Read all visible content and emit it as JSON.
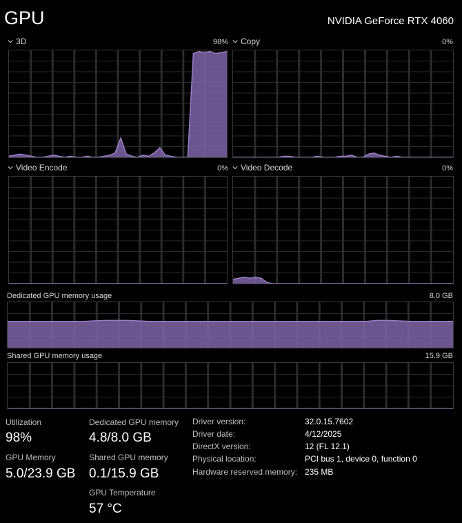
{
  "header": {
    "title": "GPU",
    "adapter_name": "NVIDIA GeForce RTX 4060"
  },
  "engines": [
    {
      "name": "3D",
      "percent": "98%"
    },
    {
      "name": "Copy",
      "percent": "0%"
    },
    {
      "name": "Video Encode",
      "percent": "0%"
    },
    {
      "name": "Video Decode",
      "percent": "0%"
    }
  ],
  "memory_graphs": [
    {
      "label": "Dedicated GPU memory usage",
      "max": "8.0 GB"
    },
    {
      "label": "Shared GPU memory usage",
      "max": "15.9 GB"
    }
  ],
  "stats": {
    "utilization": {
      "label": "Utilization",
      "value": "98%"
    },
    "gpu_memory": {
      "label": "GPU Memory",
      "value": "5.0/23.9 GB"
    },
    "dedicated": {
      "label": "Dedicated GPU memory",
      "value": "4.8/8.0 GB"
    },
    "shared": {
      "label": "Shared GPU memory",
      "value": "0.1/15.9 GB"
    },
    "temperature": {
      "label": "GPU Temperature",
      "value": "57 °C"
    }
  },
  "details": [
    {
      "key": "Driver version:",
      "value": "32.0.15.7602"
    },
    {
      "key": "Driver date:",
      "value": "4/12/2025"
    },
    {
      "key": "DirectX version:",
      "value": "12 (FL 12.1)"
    },
    {
      "key": "Physical location:",
      "value": "PCI bus 1, device 0, function 0"
    },
    {
      "key": "Hardware reserved memory:",
      "value": "235 MB"
    }
  ],
  "colors": {
    "accent": "#9b7fc6",
    "accent_fill": "#7d64a8",
    "grid": "#2b2b2b",
    "border": "#3a3a3a"
  },
  "history": {
    "3d": [
      1,
      2,
      3,
      2,
      1,
      0,
      0,
      1,
      2,
      1,
      0,
      1,
      0,
      0,
      1,
      0,
      0,
      1,
      2,
      4,
      18,
      3,
      1,
      0,
      2,
      1,
      4,
      9,
      2,
      1,
      0,
      0,
      0,
      97,
      99,
      98,
      99,
      97,
      98,
      99
    ],
    "copy": [
      0,
      0,
      0,
      0,
      0,
      0,
      0,
      0,
      0,
      1,
      1,
      0,
      0,
      0,
      0,
      1,
      0,
      0,
      0,
      1,
      1,
      2,
      0,
      0,
      3,
      4,
      2,
      1,
      0,
      1,
      0,
      0,
      0,
      0,
      0,
      0,
      0,
      0,
      0,
      0
    ],
    "encode": [
      0,
      0,
      0,
      0,
      0,
      0,
      0,
      0,
      0,
      0,
      0,
      0,
      0,
      0,
      0,
      0,
      0,
      0,
      0,
      0,
      0,
      0,
      0,
      0,
      0,
      0,
      0,
      0,
      0,
      0,
      0,
      0,
      0,
      0,
      0,
      0,
      0,
      0,
      0,
      0
    ],
    "decode": [
      4,
      5,
      6,
      5,
      6,
      5,
      1,
      0,
      0,
      0,
      0,
      0,
      0,
      0,
      0,
      0,
      0,
      0,
      0,
      0,
      0,
      0,
      0,
      0,
      0,
      0,
      0,
      0,
      0,
      0,
      0,
      0,
      0,
      0,
      0,
      0,
      0,
      0,
      0,
      0
    ],
    "dedicated": [
      58,
      58,
      58,
      58,
      58,
      58,
      58,
      58,
      59,
      60,
      60,
      60,
      59,
      58,
      58,
      58,
      58,
      58,
      58,
      58,
      58,
      58,
      58,
      58,
      58,
      58,
      58,
      58,
      58,
      58,
      58,
      58,
      58,
      58,
      60,
      60,
      59,
      58,
      58,
      58,
      58,
      58
    ],
    "shared": [
      0,
      0,
      0,
      0,
      0,
      0,
      0,
      0,
      0,
      0,
      0,
      0,
      0,
      0,
      0,
      0,
      0,
      0,
      0,
      0,
      0,
      0,
      0,
      0,
      0,
      0,
      0,
      0,
      0,
      0,
      0,
      0,
      0,
      0,
      0,
      0,
      0,
      0,
      0,
      0,
      0,
      0
    ]
  }
}
